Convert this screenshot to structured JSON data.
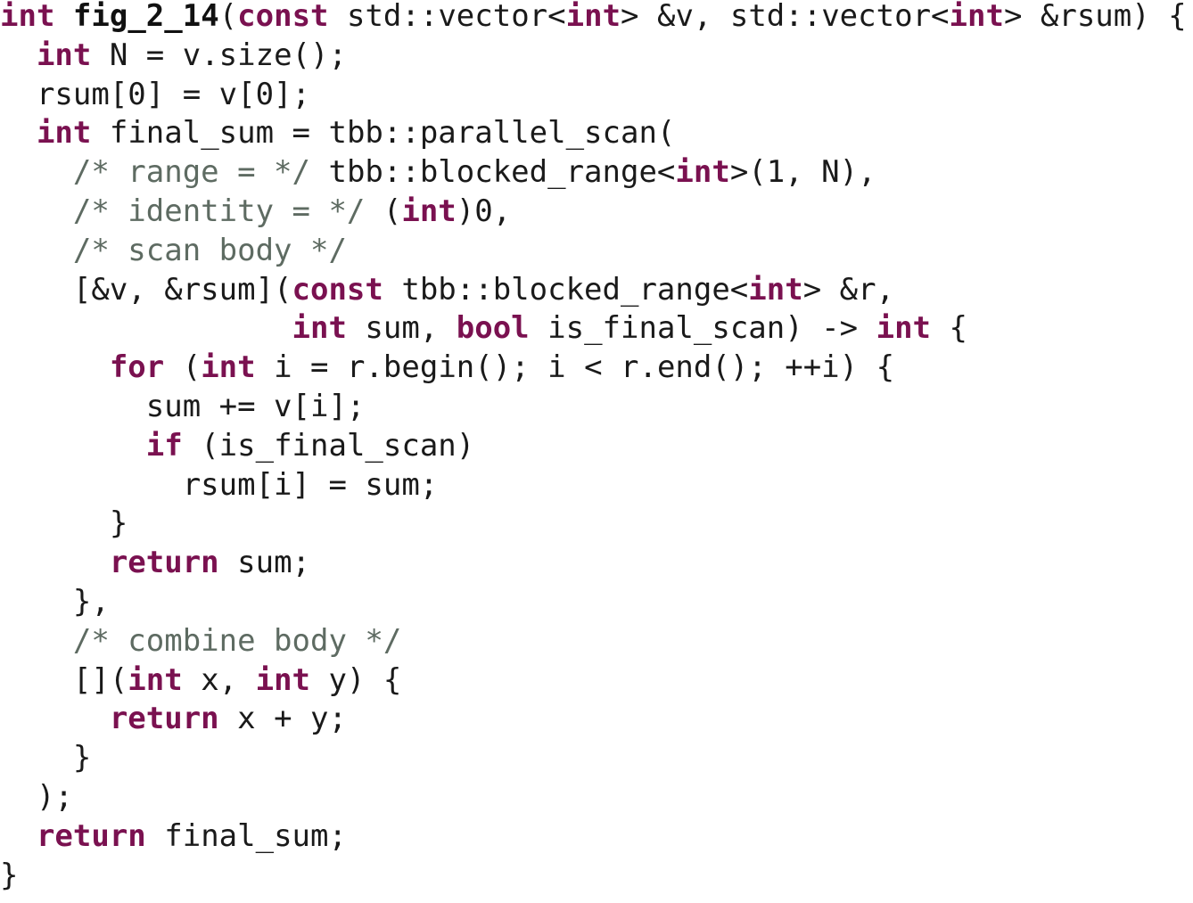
{
  "colors": {
    "background": "#ffffff",
    "text": "#1a1a1a",
    "keyword": "#7a1150",
    "comment": "#5e6b62"
  },
  "code": {
    "lines": [
      [
        {
          "t": "int",
          "k": "keyword"
        },
        {
          "t": " ",
          "k": "plain"
        },
        {
          "t": "fig_2_14",
          "k": "bold"
        },
        {
          "t": "(",
          "k": "plain"
        },
        {
          "t": "const",
          "k": "keyword"
        },
        {
          "t": " std::vector<",
          "k": "plain"
        },
        {
          "t": "int",
          "k": "keyword"
        },
        {
          "t": "> &v, std::vector<",
          "k": "plain"
        },
        {
          "t": "int",
          "k": "keyword"
        },
        {
          "t": "> &rsum) {",
          "k": "plain"
        }
      ],
      [
        {
          "t": "  ",
          "k": "plain"
        },
        {
          "t": "int",
          "k": "keyword"
        },
        {
          "t": " N = v.size();",
          "k": "plain"
        }
      ],
      [
        {
          "t": "  rsum[0] = v[0];",
          "k": "plain"
        }
      ],
      [
        {
          "t": "  ",
          "k": "plain"
        },
        {
          "t": "int",
          "k": "keyword"
        },
        {
          "t": " final_sum = tbb::parallel_scan(",
          "k": "plain"
        }
      ],
      [
        {
          "t": "    ",
          "k": "plain"
        },
        {
          "t": "/* range = */",
          "k": "comment"
        },
        {
          "t": " tbb::blocked_range<",
          "k": "plain"
        },
        {
          "t": "int",
          "k": "keyword"
        },
        {
          "t": ">(1, N),",
          "k": "plain"
        }
      ],
      [
        {
          "t": "    ",
          "k": "plain"
        },
        {
          "t": "/* identity = */",
          "k": "comment"
        },
        {
          "t": " (",
          "k": "plain"
        },
        {
          "t": "int",
          "k": "keyword"
        },
        {
          "t": ")0,",
          "k": "plain"
        }
      ],
      [
        {
          "t": "    ",
          "k": "plain"
        },
        {
          "t": "/* scan body */",
          "k": "comment"
        }
      ],
      [
        {
          "t": "    [&v, &rsum](",
          "k": "plain"
        },
        {
          "t": "const",
          "k": "keyword"
        },
        {
          "t": " tbb::blocked_range<",
          "k": "plain"
        },
        {
          "t": "int",
          "k": "keyword"
        },
        {
          "t": "> &r,",
          "k": "plain"
        }
      ],
      [
        {
          "t": "                ",
          "k": "plain"
        },
        {
          "t": "int",
          "k": "keyword"
        },
        {
          "t": " sum, ",
          "k": "plain"
        },
        {
          "t": "bool",
          "k": "keyword"
        },
        {
          "t": " is_final_scan) -> ",
          "k": "plain"
        },
        {
          "t": "int",
          "k": "keyword"
        },
        {
          "t": " {",
          "k": "plain"
        }
      ],
      [
        {
          "t": "      ",
          "k": "plain"
        },
        {
          "t": "for",
          "k": "keyword"
        },
        {
          "t": " (",
          "k": "plain"
        },
        {
          "t": "int",
          "k": "keyword"
        },
        {
          "t": " i = r.begin(); i < r.end(); ++i) {",
          "k": "plain"
        }
      ],
      [
        {
          "t": "        sum += v[i];",
          "k": "plain"
        }
      ],
      [
        {
          "t": "        ",
          "k": "plain"
        },
        {
          "t": "if",
          "k": "keyword"
        },
        {
          "t": " (is_final_scan)",
          "k": "plain"
        }
      ],
      [
        {
          "t": "          rsum[i] = sum;",
          "k": "plain"
        }
      ],
      [
        {
          "t": "      }",
          "k": "plain"
        }
      ],
      [
        {
          "t": "      ",
          "k": "plain"
        },
        {
          "t": "return",
          "k": "keyword"
        },
        {
          "t": " sum;",
          "k": "plain"
        }
      ],
      [
        {
          "t": "    },",
          "k": "plain"
        }
      ],
      [
        {
          "t": "    ",
          "k": "plain"
        },
        {
          "t": "/* combine body */",
          "k": "comment"
        }
      ],
      [
        {
          "t": "    [](",
          "k": "plain"
        },
        {
          "t": "int",
          "k": "keyword"
        },
        {
          "t": " x, ",
          "k": "plain"
        },
        {
          "t": "int",
          "k": "keyword"
        },
        {
          "t": " y) {",
          "k": "plain"
        }
      ],
      [
        {
          "t": "      ",
          "k": "plain"
        },
        {
          "t": "return",
          "k": "keyword"
        },
        {
          "t": " x + y;",
          "k": "plain"
        }
      ],
      [
        {
          "t": "    }",
          "k": "plain"
        }
      ],
      [
        {
          "t": "  );",
          "k": "plain"
        }
      ],
      [
        {
          "t": "  ",
          "k": "plain"
        },
        {
          "t": "return",
          "k": "keyword"
        },
        {
          "t": " final_sum;",
          "k": "plain"
        }
      ],
      [
        {
          "t": "}",
          "k": "plain"
        }
      ]
    ]
  }
}
